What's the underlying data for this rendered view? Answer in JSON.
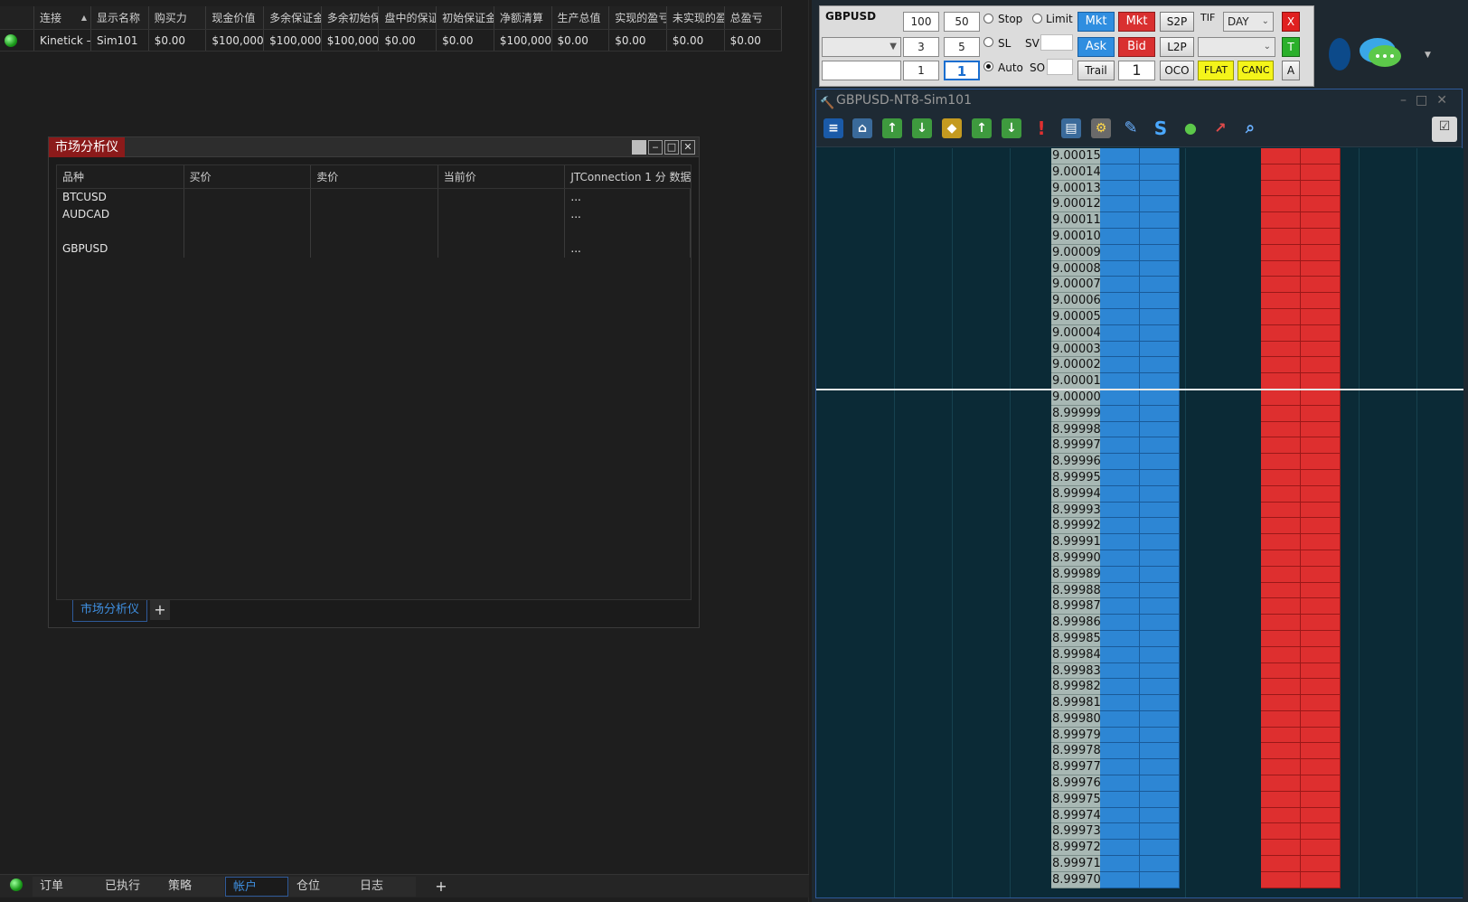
{
  "accounts": {
    "headers": [
      "连接",
      "显示名称",
      "购买力",
      "现金价值",
      "多余保证金",
      "多余初始保",
      "盘中的保证",
      "初始保证金",
      "净额清算",
      "生产总值",
      "实现的盈亏",
      "未实现的盈",
      "总盈亏"
    ],
    "row": [
      "Kinetick –",
      "Sim101",
      "$0.00",
      "$100,000",
      "$100,000",
      "$100,000",
      "$0.00",
      "$0.00",
      "$100,000",
      "$0.00",
      "$0.00",
      "$0.00",
      "$0.00"
    ]
  },
  "market_analyzer": {
    "title": "市场分析仪",
    "columns": [
      "品种",
      "买价",
      "卖价",
      "当前价",
      "JTConnection 1 分 数据"
    ],
    "rows": [
      {
        "instrument": "BTCUSD",
        "last": "..."
      },
      {
        "instrument": "AUDCAD",
        "last": "..."
      },
      {
        "instrument": "",
        "last": ""
      },
      {
        "instrument": "GBPUSD",
        "last": "..."
      }
    ],
    "tab_label": "市场分析仪",
    "add_tab": "+"
  },
  "bottom_tabs": {
    "items": [
      "订单",
      "已执行",
      "策略",
      "帐户",
      "仓位",
      "日志"
    ],
    "active": "帐户",
    "add": "+"
  },
  "order_panel": {
    "instrument": "GBPUSD",
    "qty_presets": [
      "100",
      "50",
      "3",
      "5",
      "1",
      "1"
    ],
    "radio_stop": "Stop",
    "radio_limit": "Limit",
    "radio_sl": "SL",
    "radio_auto": "Auto",
    "sv_label": "SV",
    "so_label": "SO",
    "buy_mkt": "Mkt",
    "sell_mkt": "Mkt",
    "ask": "Ask",
    "bid": "Bid",
    "s2p": "S2P",
    "l2p": "L2P",
    "trail": "Trail",
    "qty": "1",
    "oco": "OCO",
    "tif_label": "TIF",
    "tif_value": "DAY",
    "close_x": "X",
    "t_btn": "T",
    "flat": "FLAT",
    "canc": "CANC",
    "a_btn": "A"
  },
  "dom": {
    "window_title": "GBPUSD-NT8-Sim101",
    "prices": [
      "9.00015",
      "9.00014",
      "9.00013",
      "9.00012",
      "9.00011",
      "9.00010",
      "9.00009",
      "9.00008",
      "9.00007",
      "9.00006",
      "9.00005",
      "9.00004",
      "9.00003",
      "9.00002",
      "9.00001",
      "9.00000",
      "8.99999",
      "8.99998",
      "8.99997",
      "8.99996",
      "8.99995",
      "8.99994",
      "8.99993",
      "8.99992",
      "8.99991",
      "8.99990",
      "8.99989",
      "8.99988",
      "8.99987",
      "8.99986",
      "8.99985",
      "8.99984",
      "8.99983",
      "8.99982",
      "8.99981",
      "8.99980",
      "8.99979",
      "8.99978",
      "8.99977",
      "8.99976",
      "8.99975",
      "8.99974",
      "8.99973",
      "8.99972",
      "8.99971",
      "8.99970"
    ],
    "current_price": "9.00000",
    "colors": {
      "bid": "#2d86d4",
      "ask": "#de2f2f",
      "price_bg": "#a8b8b4",
      "grid_bg": "#0b2a36"
    }
  }
}
